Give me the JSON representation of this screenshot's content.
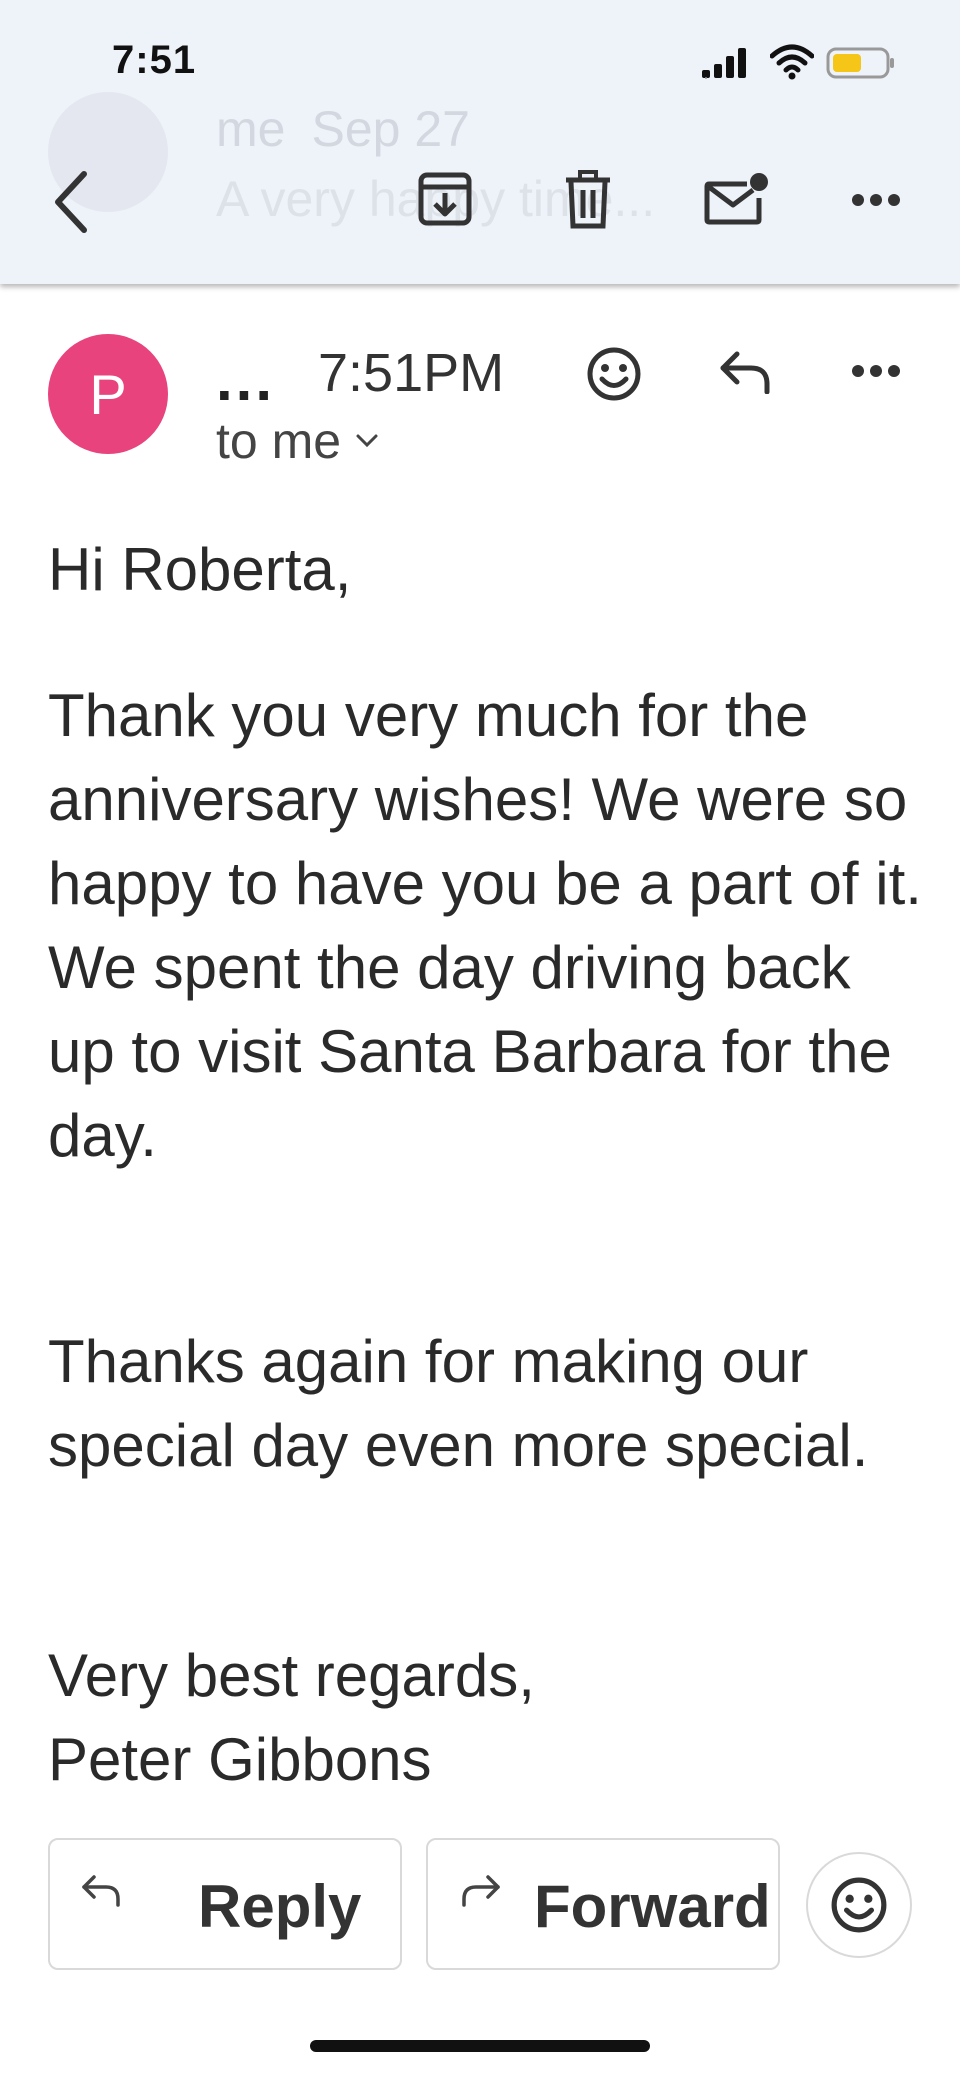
{
  "status_bar": {
    "time": "7:51",
    "battery_color": "#f5c518"
  },
  "top_bar": {
    "ghost_sender": "me",
    "ghost_date": "Sep 27",
    "ghost_subject": "A very happy time..."
  },
  "message": {
    "avatar_letter": "P",
    "avatar_color": "#e8437d",
    "sender_short": "...",
    "time": "7:51PM",
    "recipients": "to me"
  },
  "body": {
    "greeting": "Hi Roberta,",
    "paragraph1": "Thank you very much for the anniversary wishes! We were so happy to have you be a part of it. We spent the day driving back up to visit Santa Barbara for the day.",
    "paragraph2": "Thanks again for making our special day even more special.",
    "closing": "Very best regards,",
    "signature": "Peter Gibbons"
  },
  "actions": {
    "reply_label": "Reply",
    "forward_label": "Forward"
  },
  "icons": {
    "back": "chevron-left-icon",
    "archive": "archive-icon",
    "delete": "trash-icon",
    "mark_unread": "mail-unread-icon",
    "more": "more-horizontal-icon",
    "emoji": "smiley-icon",
    "reply": "reply-icon",
    "forward": "forward-icon"
  }
}
